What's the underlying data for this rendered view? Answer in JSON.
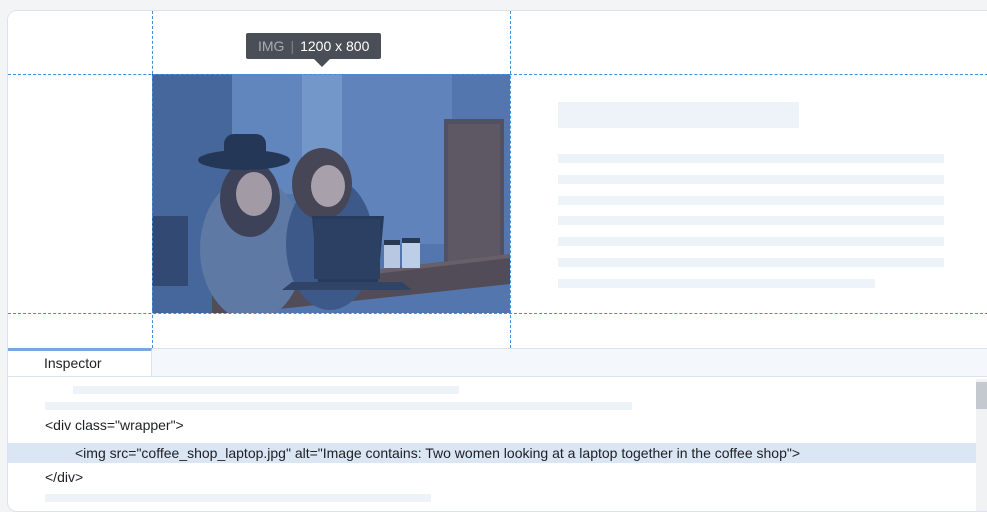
{
  "tooltip": {
    "tag": "IMG",
    "separator": "|",
    "dimensions": "1200 x 800"
  },
  "inspector": {
    "tab_label": "Inspector",
    "code": {
      "line_open": "<div class=\"wrapper\">",
      "line_img": "<img src=\"coffee_shop_laptop.jpg\" alt=\"Image contains: Two women looking at a laptop together in the coffee shop\">",
      "line_close": "</div>"
    }
  },
  "image": {
    "file": "coffee_shop_laptop.jpg",
    "alt": "Image contains: Two women looking at a laptop together in the coffee shop"
  },
  "colors": {
    "guide": "#3f8fe0",
    "selection": "#dbe6f5",
    "skeleton": "#eef3f9",
    "tooltip_bg": "#4a4f57",
    "tab_accent": "#7aa7df"
  }
}
